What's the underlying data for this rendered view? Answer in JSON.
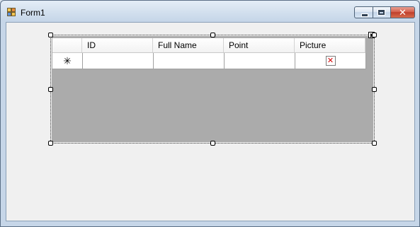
{
  "window": {
    "title": "Form1",
    "icon": "form-app-icon",
    "caption_buttons": [
      "minimize-icon",
      "maximize-icon",
      "close-icon"
    ],
    "colors": {
      "titlebar": "#c6d6e8",
      "close": "#d4604c"
    }
  },
  "datagrid": {
    "columns": [
      "ID",
      "Full Name",
      "Point",
      "Picture"
    ],
    "new_row_glyph": "✳",
    "new_row_icon": "asterisk-icon",
    "picture_icon": "broken-image-icon",
    "picture_glyph": "✕",
    "background_color": "#ababab"
  }
}
